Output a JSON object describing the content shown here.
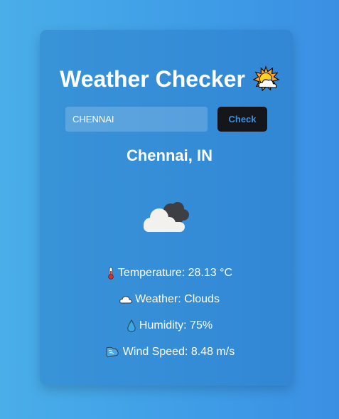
{
  "app": {
    "title": "Weather Checker",
    "title_icon": "sun-behind-cloud-icon"
  },
  "search": {
    "value": "CHENNAI",
    "button_label": "Check"
  },
  "result": {
    "location": "Chennai, IN",
    "condition_icon": "cloud-icon",
    "details": {
      "temperature": "Temperature: 28.13 °C",
      "weather": "Weather: Clouds",
      "humidity": "Humidity: 75%",
      "wind": "Wind Speed: 8.48 m/s"
    }
  },
  "colors": {
    "background_start": "#4aaee9",
    "background_end": "#3b8fe3",
    "button_bg": "#14161b",
    "button_text": "#3b8fe0",
    "text": "#ffffff"
  }
}
